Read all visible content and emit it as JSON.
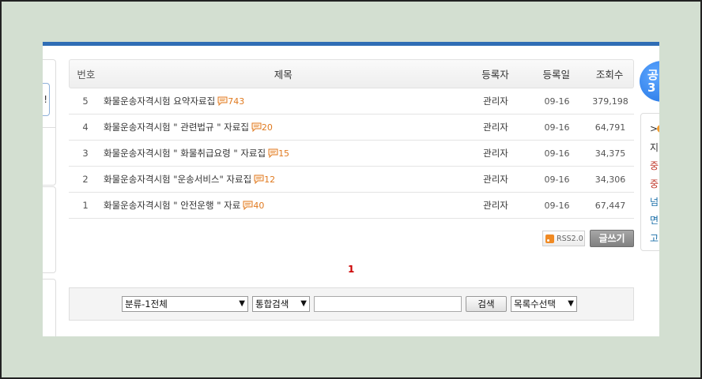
{
  "board": {
    "columns": {
      "no": "번호",
      "title": "제목",
      "author": "등록자",
      "date": "등록일",
      "views": "조회수"
    },
    "rows": [
      {
        "no": "5",
        "title": "화물운송자격시험 요약자료집",
        "comments": "743",
        "author": "관리자",
        "date": "09-16",
        "views": "379,198"
      },
      {
        "no": "4",
        "title": "화물운송자격시험 \" 관련법규 \" 자료집",
        "comments": "20",
        "author": "관리자",
        "date": "09-16",
        "views": "64,791"
      },
      {
        "no": "3",
        "title": "화물운송자격시험 \" 화물취급요령 \" 자료집",
        "comments": "15",
        "author": "관리자",
        "date": "09-16",
        "views": "34,375"
      },
      {
        "no": "2",
        "title": "화물운송자격시험 \"운송서비스\" 자료집",
        "comments": "12",
        "author": "관리자",
        "date": "09-16",
        "views": "34,306"
      },
      {
        "no": "1",
        "title": "화물운송자격시험 \" 안전운행 \" 자료",
        "comments": "40",
        "author": "관리자",
        "date": "09-16",
        "views": "67,447"
      }
    ],
    "rss_label": "RSS2.0",
    "write_label": "글쓰기",
    "page": "1"
  },
  "search": {
    "category_value": "분류-1전체",
    "scope_value": "통합검색",
    "query_value": "",
    "button_label": "검색",
    "list_count_value": "목록수선택"
  },
  "left": {
    "input_fragment": "!"
  },
  "right": {
    "circle_text": "공\n3",
    "items": [
      ">",
      "지",
      "중",
      "중",
      "넘",
      "면",
      "고"
    ],
    "item_colors": [
      "#333333",
      "#333333",
      "#c0392b",
      "#c0392b",
      "#1a6fa8",
      "#1a6fa8",
      "#1a6fa8"
    ]
  },
  "colors": {
    "accent": "#2f6db5",
    "comment": "#e07a20",
    "page_current": "#cc0000"
  },
  "icons": {
    "comment": "comment-icon",
    "rss": "rss-icon"
  }
}
